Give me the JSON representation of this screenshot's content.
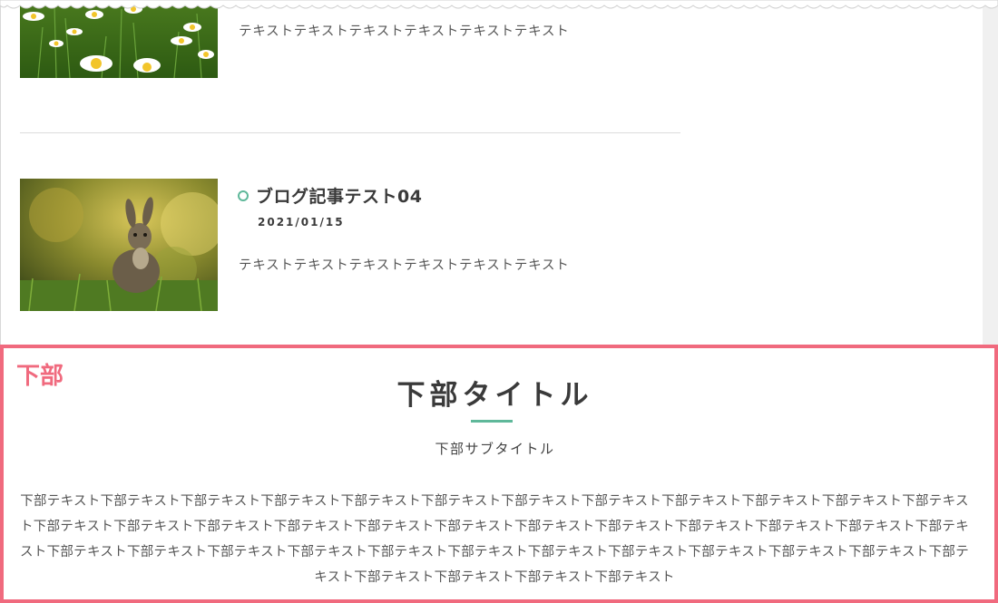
{
  "posts": [
    {
      "excerpt": "テキストテキストテキストテキストテキストテキスト",
      "thumbnail": "daisy-field-photo"
    },
    {
      "title": "ブログ記事テスト04",
      "date": "2021/01/15",
      "excerpt": "テキストテキストテキストテキストテキストテキスト",
      "thumbnail": "wild-rabbit-photo"
    }
  ],
  "bottom_section": {
    "tag": "下部",
    "title": "下部タイトル",
    "subtitle": "下部サブタイトル",
    "body": "下部テキスト下部テキスト下部テキスト下部テキスト下部テキスト下部テキスト下部テキスト下部テキスト下部テキスト下部テキスト下部テキスト下部テキスト下部テキスト下部テキスト下部テキスト下部テキスト下部テキスト下部テキスト下部テキスト下部テキスト下部テキスト下部テキスト下部テキスト下部テキスト下部テキスト下部テキスト下部テキスト下部テキスト下部テキスト下部テキスト下部テキスト下部テキスト下部テキスト下部テキスト下部テキスト下部テキスト下部テキスト下部テキスト下部テキスト下部テキスト"
  },
  "colors": {
    "accent_green": "#5fb89a",
    "highlight_border": "#f06a7e",
    "heading_text": "#3a3a3a"
  }
}
